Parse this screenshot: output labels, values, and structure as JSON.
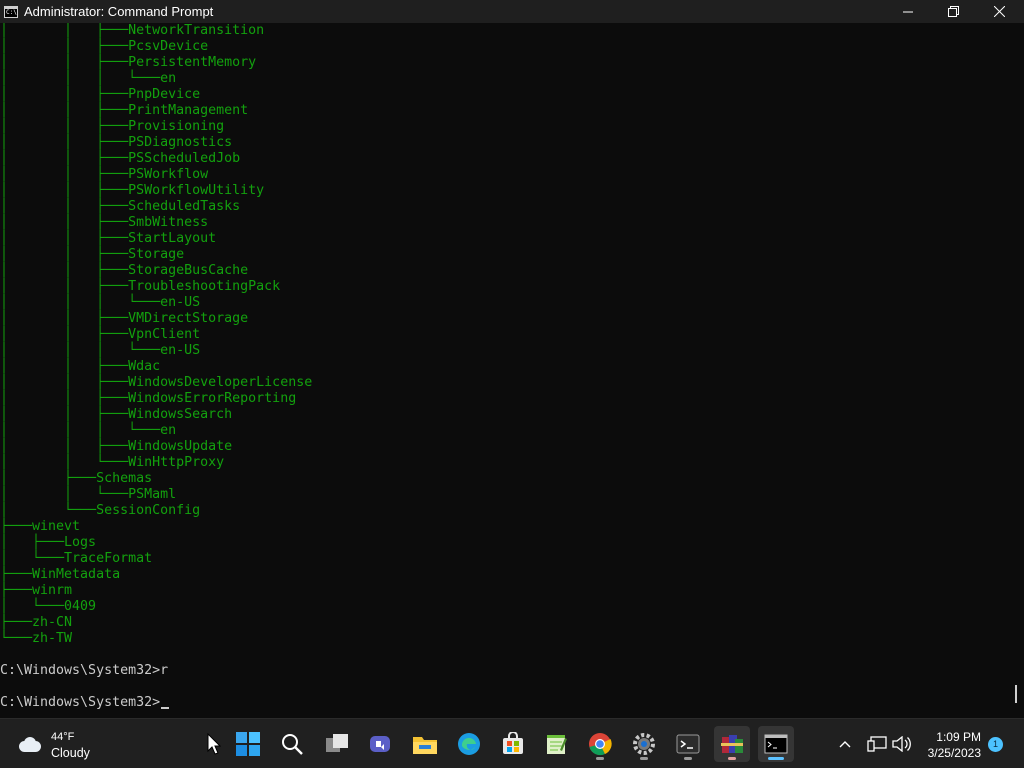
{
  "window": {
    "title": "Administrator: Command Prompt",
    "icon_label": "C:\\",
    "controls": {
      "minimize": "minimize-icon",
      "restore": "restore-icon",
      "close": "close-icon"
    }
  },
  "terminal": {
    "colors": {
      "tree": "#13a10e",
      "text": "#cccccc",
      "background": "#0c0c0c"
    },
    "tree_lines": [
      "│       │   ├───NetworkTransition",
      "│       │   ├───PcsvDevice",
      "│       │   ├───PersistentMemory",
      "│       │   │   └───en",
      "│       │   ├───PnpDevice",
      "│       │   ├───PrintManagement",
      "│       │   ├───Provisioning",
      "│       │   ├───PSDiagnostics",
      "│       │   ├───PSScheduledJob",
      "│       │   ├───PSWorkflow",
      "│       │   ├───PSWorkflowUtility",
      "│       │   ├───ScheduledTasks",
      "│       │   ├───SmbWitness",
      "│       │   ├───StartLayout",
      "│       │   ├───Storage",
      "│       │   ├───StorageBusCache",
      "│       │   ├───TroubleshootingPack",
      "│       │   │   └───en-US",
      "│       │   ├───VMDirectStorage",
      "│       │   ├───VpnClient",
      "│       │   │   └───en-US",
      "│       │   ├───Wdac",
      "│       │   ├───WindowsDeveloperLicense",
      "│       │   ├───WindowsErrorReporting",
      "│       │   ├───WindowsSearch",
      "│       │   │   └───en",
      "│       │   ├───WindowsUpdate",
      "│       │   └───WinHttpProxy",
      "│       ├───Schemas",
      "│       │   └───PSMaml",
      "│       └───SessionConfig",
      "├───winevt",
      "│   ├───Logs",
      "│   └───TraceFormat",
      "├───WinMetadata",
      "├───winrm",
      "│   └───0409",
      "├───zh-CN",
      "└───zh-TW"
    ],
    "prompt_lines": [
      "C:\\Windows\\System32>r",
      "C:\\Windows\\System32>"
    ]
  },
  "taskbar": {
    "weather": {
      "temperature": "44°F",
      "condition": "Cloudy",
      "icon": "cloud-icon"
    },
    "apps": [
      {
        "name": "start-button",
        "icon": "windows-logo-icon"
      },
      {
        "name": "search-button",
        "icon": "search-icon"
      },
      {
        "name": "task-view-button",
        "icon": "task-view-icon"
      },
      {
        "name": "teams-chat-button",
        "icon": "teams-icon"
      },
      {
        "name": "file-explorer-button",
        "icon": "folder-icon"
      },
      {
        "name": "edge-button",
        "icon": "edge-icon"
      },
      {
        "name": "store-button",
        "icon": "store-icon"
      },
      {
        "name": "notepad-plus-button",
        "icon": "notepad-icon"
      },
      {
        "name": "chrome-button",
        "icon": "chrome-icon"
      },
      {
        "name": "settings-button",
        "icon": "gear-icon"
      },
      {
        "name": "terminal-button",
        "icon": "terminal-icon"
      },
      {
        "name": "winrar-button",
        "icon": "archive-icon"
      },
      {
        "name": "command-prompt-button",
        "icon": "cmd-icon"
      }
    ],
    "tray": {
      "chevron": "chevron-up-icon",
      "network": "network-icon",
      "volume": "volume-icon"
    },
    "clock": {
      "time": "1:09 PM",
      "date": "3/25/2023"
    },
    "notification_count": "1"
  }
}
